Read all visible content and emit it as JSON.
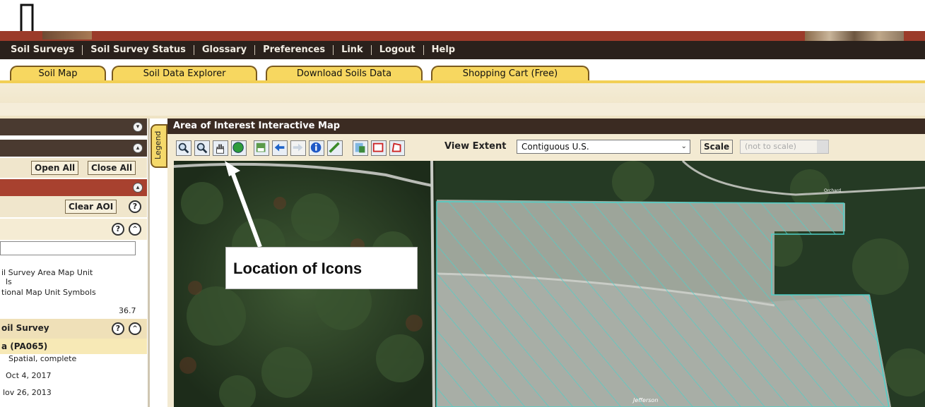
{
  "menu": {
    "items": [
      "Soil Surveys",
      "Soil Survey Status",
      "Glossary",
      "Preferences",
      "Link",
      "Logout",
      "Help"
    ]
  },
  "tabs": [
    "Soil Map",
    "Soil Data Explorer",
    "Download Soils Data",
    "Shopping Cart (Free)"
  ],
  "left_panel": {
    "open_all": "Open All",
    "close_all": "Close All",
    "clear_aoi": "Clear AOI",
    "help_glyph": "?",
    "text_lines": [
      "il Survey Area Map Unit",
      "ls",
      "tional Map Unit Symbols"
    ],
    "value": "36.7",
    "survey_header": "oil Survey",
    "survey_code": "a (PA065)",
    "status": "Spatial, complete",
    "date1": "Oct 4, 2017",
    "date2": "lov 26, 2013"
  },
  "map": {
    "legend_label": "Legend",
    "title": "Area of Interest Interactive Map",
    "view_extent_label": "View Extent",
    "view_extent_value": "Contiguous U.S.",
    "scale_label": "Scale",
    "scale_value": "(not to scale)",
    "road_label": "Jefferson",
    "road_label_top": "Orchard",
    "toolbar_icons": [
      "zoom-in-icon",
      "zoom-out-icon",
      "pan-hand-icon",
      "globe-icon",
      "aoi-icon",
      "back-arrow-icon",
      "forward-arrow-icon",
      "info-icon",
      "measure-icon",
      "identify-icon",
      "aoi-rectangle-icon",
      "aoi-polygon-icon"
    ]
  },
  "annotation": {
    "callout_text": "Location of Icons"
  },
  "colors": {
    "menu_bg": "#2a211c",
    "banner": "#9b3b2a",
    "tab_fill": "#f7d760",
    "aoi_hatch": "#4fd0c8"
  }
}
